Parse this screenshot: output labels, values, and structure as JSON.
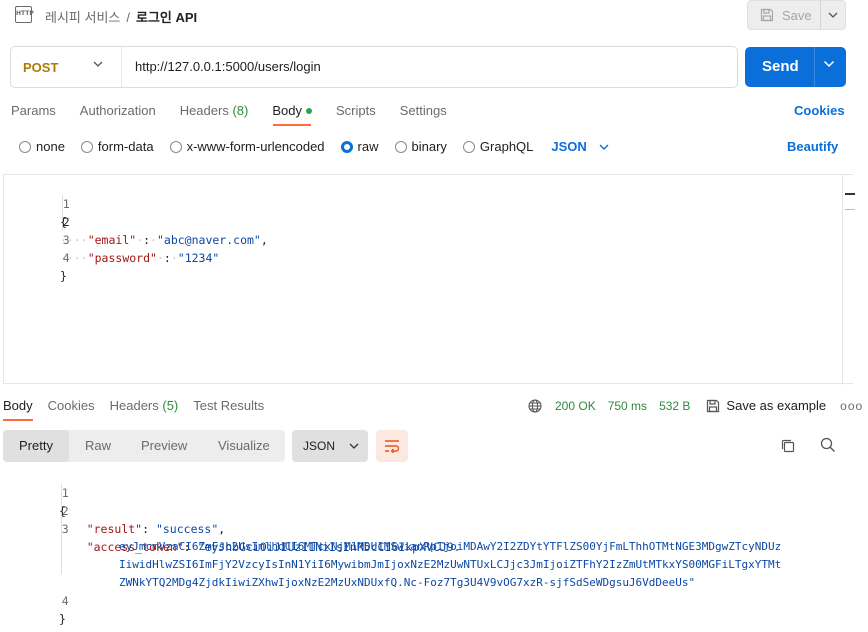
{
  "breadcrumb": {
    "icon": "http-file-icon",
    "icon_text": "HTTP",
    "parent": "레시피 서비스",
    "separator": "/",
    "current": "로그인 API"
  },
  "toolbar": {
    "save_label": "Save"
  },
  "request": {
    "method": "POST",
    "url": "http://127.0.0.1:5000/users/login",
    "send_label": "Send"
  },
  "request_tabs": {
    "params": "Params",
    "authorization": "Authorization",
    "headers": "Headers",
    "headers_count": "(8)",
    "body": "Body",
    "scripts": "Scripts",
    "settings": "Settings",
    "cookies": "Cookies",
    "active": "Body"
  },
  "body_types": {
    "none": "none",
    "form_data": "form-data",
    "urlencoded": "x-www-form-urlencoded",
    "raw": "raw",
    "binary": "binary",
    "graphql": "GraphQL",
    "selected": "raw",
    "format": "JSON",
    "beautify": "Beautify"
  },
  "request_body": {
    "line_numbers": [
      "1",
      "2",
      "3",
      "4"
    ],
    "open_brace": "{",
    "email_key": "\"email\"",
    "email_value": "\"abc@naver.com\"",
    "password_key": "\"password\"",
    "password_value": "\"1234\"",
    "close_brace": "}",
    "indent_dots": "····",
    "colon": ":",
    "comma": ","
  },
  "response_tabs": {
    "body": "Body",
    "cookies": "Cookies",
    "headers": "Headers",
    "headers_count": "(5)",
    "test_results": "Test Results"
  },
  "response_meta": {
    "status": "200 OK",
    "time": "750 ms",
    "size": "532 B",
    "save_example": "Save as example",
    "more": "ooo"
  },
  "response_view": {
    "pretty": "Pretty",
    "raw": "Raw",
    "preview": "Preview",
    "visualize": "Visualize",
    "active": "Pretty",
    "format": "JSON"
  },
  "response_body": {
    "line_numbers": [
      "1",
      "2",
      "3",
      "4"
    ],
    "open_brace": "{",
    "result_key": "\"result\"",
    "result_value": "\"success\"",
    "token_key": "\"access_token\"",
    "token_line1": "\"eyJhbGciOiJIUzI1NiIsInR5cCI6IkpXVCJ9.",
    "token_line2": "eyJmcmVzaCI6ZmFsc2UsImlhdCI6MTcxNjM1MDU1MSwianRpIjoiMDAwY2I2ZDYtYTFlZS00YjFmLThhOTMtNGE3MDgwZTcyNDUz",
    "token_line3": "IiwidHlwZSI6ImFjY2VzcyIsInN1YiI6MywibmJmIjoxNzE2MzUwNTUxLCJjc3JmIjoiZTFhY2IzZmUtMTkxYS00MGFiLTgxYTMt",
    "token_line4": "ZWNkYTQ2MDg4ZjdkIiwiZXhwIjoxNzE2MzUxNDUxfQ.Nc-Foz7Tg3U4V9vOG7xzR-sjfSdSeWDgsuJ6VdDeeUs\"",
    "close_brace": "}"
  },
  "colors": {
    "accent_blue": "#0a6fd9",
    "method_post": "#ad7a03",
    "success_green": "#2e8b3a",
    "tab_underline": "#ff6c37",
    "json_key": "#a31515",
    "json_string": "#0b48a6"
  }
}
